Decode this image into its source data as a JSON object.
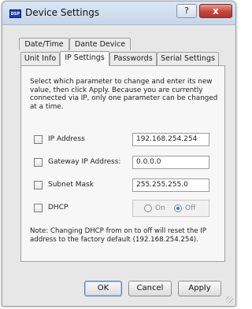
{
  "window": {
    "title": "Device Settings",
    "app_icon_text": "DSP",
    "help_glyph": "?",
    "close_glyph": "x"
  },
  "tabs": {
    "row1": [
      "Date/Time",
      "Dante Device"
    ],
    "row2": [
      "Unit Info",
      "IP Settings",
      "Passwords",
      "Serial Settings"
    ],
    "active": "IP Settings"
  },
  "ip_settings": {
    "instructions": "Select which parameter to change and enter its new value, then click Apply.  Because you are currently connected via IP, only one parameter can be changed at a time.",
    "ip_address": {
      "label": "IP Address",
      "value": "192.168.254.254",
      "checked": false
    },
    "gateway": {
      "label": "Gateway IP Address:",
      "value": "0.0.0.0",
      "checked": false
    },
    "subnet": {
      "label": "Subnet Mask",
      "value": "255.255.255.0",
      "checked": false
    },
    "dhcp": {
      "label": "DHCP",
      "on_label": "On",
      "off_label": "Off",
      "selected": "Off",
      "checked": false
    },
    "note": "Note: Changing DHCP from on to off will reset the IP address to the factory default (192.168.254.254)."
  },
  "buttons": {
    "ok": "OK",
    "cancel": "Cancel",
    "apply": "Apply"
  },
  "colors": {
    "titlebar": "#c6d6ea",
    "close_button": "#c4473a",
    "app_icon": "#1f3fb5",
    "radio_selected": "#3a7bd5"
  }
}
